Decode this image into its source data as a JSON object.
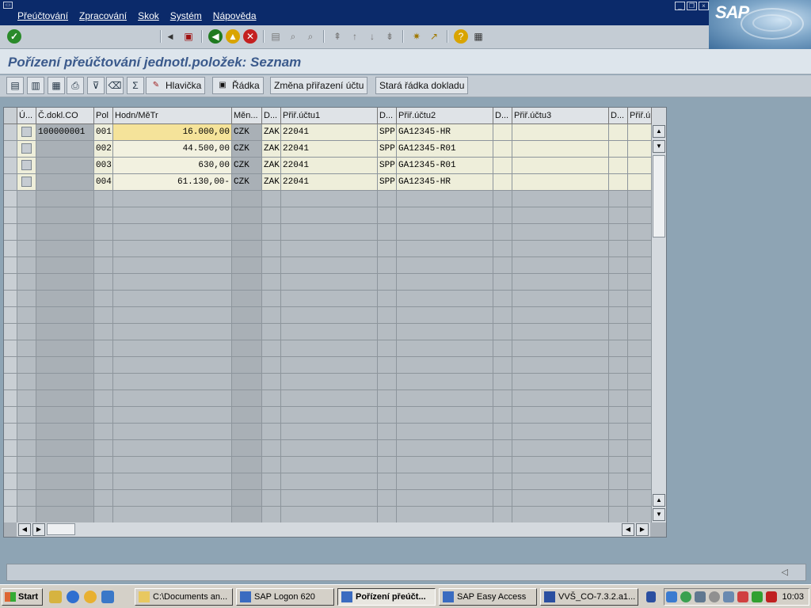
{
  "menubar": {
    "items": [
      "Přeúčtování",
      "Zpracování",
      "Skok",
      "Systém",
      "Nápověda"
    ]
  },
  "logo": "SAP",
  "system_toolbar": {
    "command_value": ""
  },
  "title": "Pořízení přeúčtování jednotl.položek: Seznam",
  "app_toolbar": {
    "header_button": "Hlavička",
    "row_button": "Řádka",
    "change_assignment_button": "Změna přiřazení účtu",
    "old_row_button": "Stará řádka dokladu"
  },
  "table": {
    "columns": [
      "Ú...",
      "Č.dokl.CO",
      "Pol",
      "Hodn/MěTr",
      "Měn...",
      "D...",
      "Přiř.účtu1",
      "D...",
      "Přiř.účtu2",
      "D...",
      "Přiř.účtu3",
      "D...",
      "Přiř.ú"
    ],
    "rows": [
      {
        "doc": "100000001",
        "pol": "001",
        "hodn": "16.000,00",
        "men": "CZK",
        "d1": "ZAK",
        "pr1": "22041",
        "d2": "SPP",
        "pr2": "GA12345-HR"
      },
      {
        "doc": "",
        "pol": "002",
        "hodn": "44.500,00",
        "men": "CZK",
        "d1": "ZAK",
        "pr1": "22041",
        "d2": "SPP",
        "pr2": "GA12345-R01"
      },
      {
        "doc": "",
        "pol": "003",
        "hodn": "630,00",
        "men": "CZK",
        "d1": "ZAK",
        "pr1": "22041",
        "d2": "SPP",
        "pr2": "GA12345-R01"
      },
      {
        "doc": "",
        "pol": "004",
        "hodn": "61.130,00-",
        "men": "CZK",
        "d1": "ZAK",
        "pr1": "22041",
        "d2": "SPP",
        "pr2": "GA12345-HR"
      }
    ]
  },
  "taskbar": {
    "start": "Start",
    "tasks": [
      "C:\\Documents an...",
      "SAP Logon 620",
      "Pořízení přeúčt...",
      "SAP Easy Access",
      "VVŠ_CO-7.3.2.a1..."
    ],
    "clock": "10:03"
  },
  "colors": {
    "menubar": "#0b2a6a",
    "title": "#3b5a8c",
    "highlight_cell": "#f5e39a"
  }
}
